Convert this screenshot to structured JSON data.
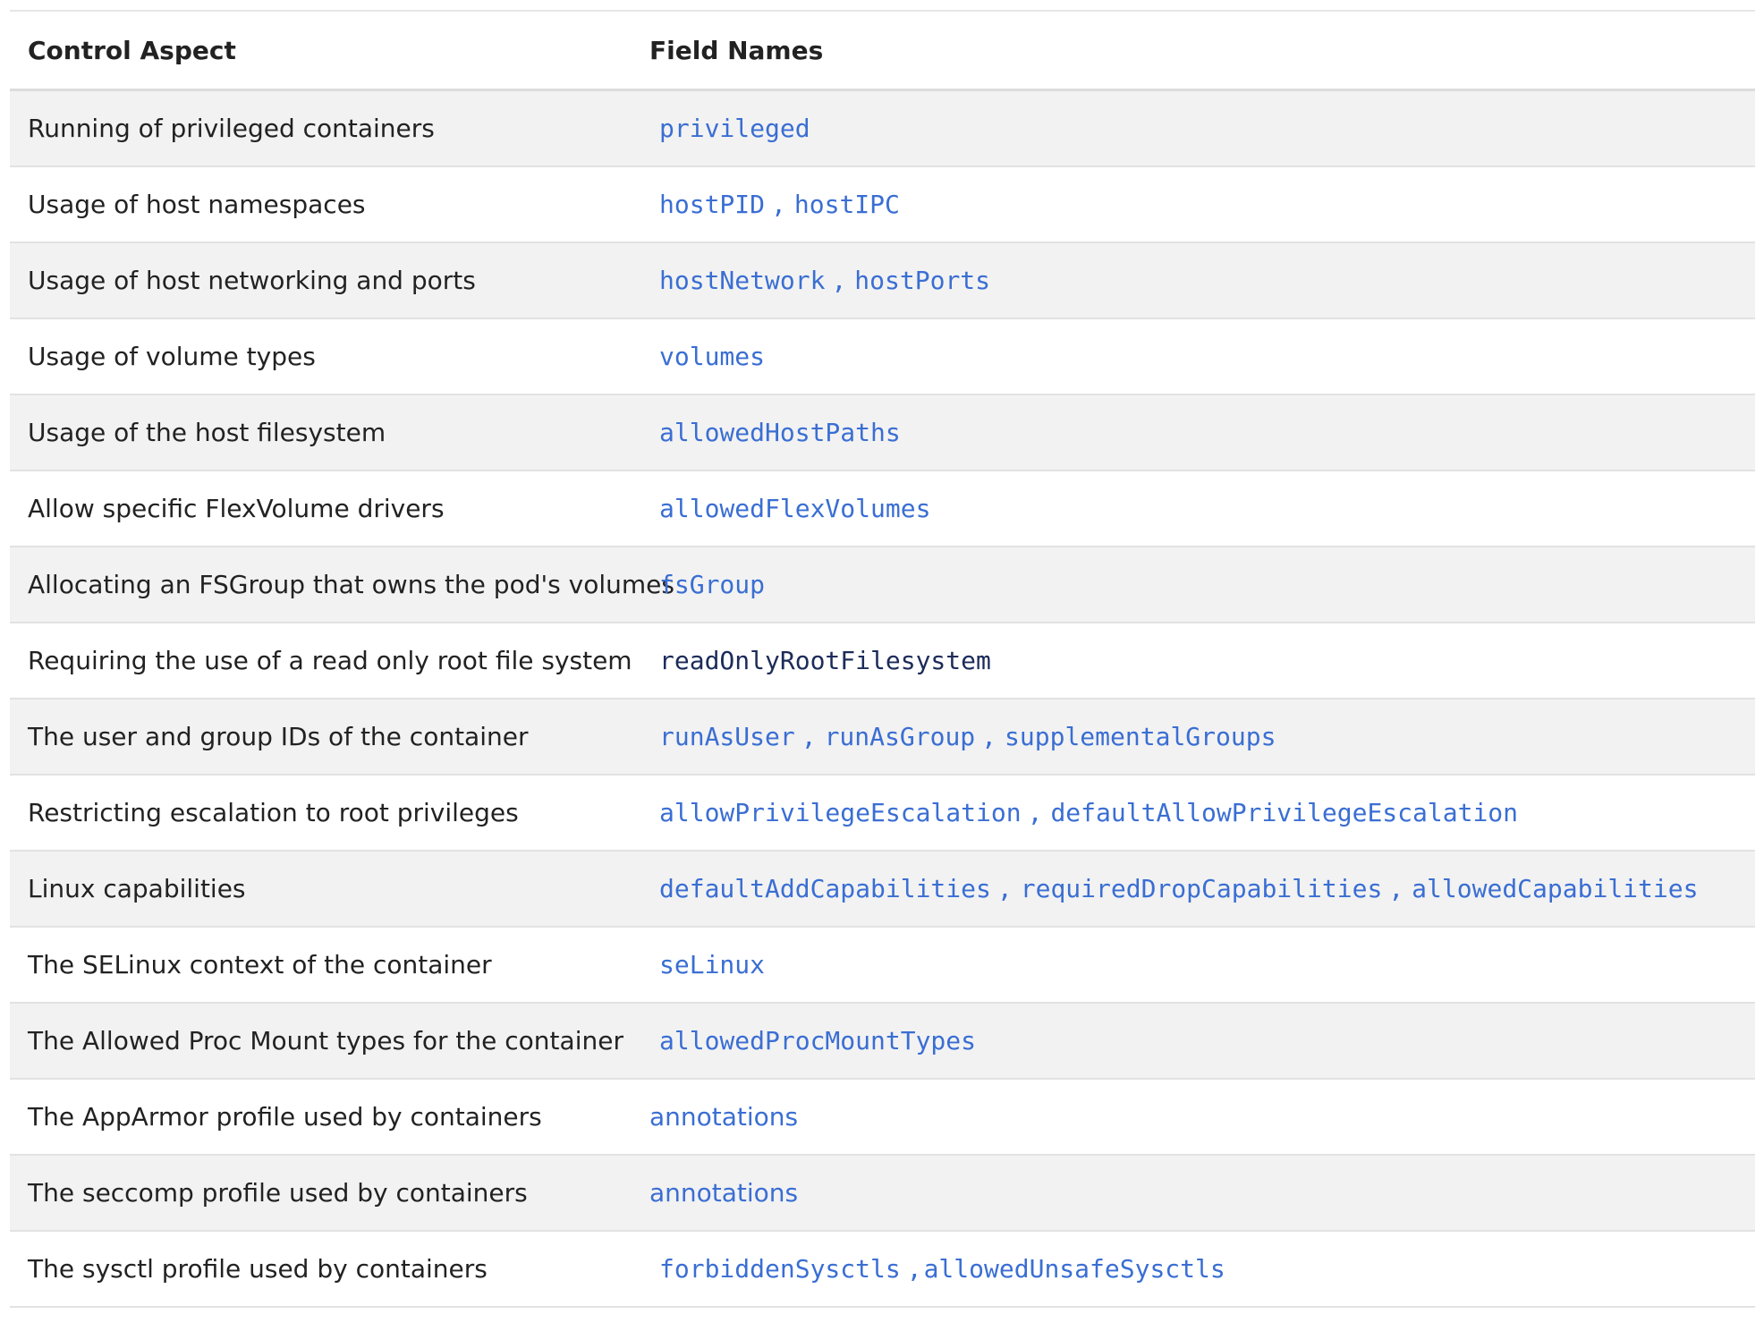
{
  "headers": {
    "aspect": "Control Aspect",
    "fields": "Field Names"
  },
  "rows": [
    {
      "aspect": "Running of privileged containers",
      "fields": [
        "privileged"
      ]
    },
    {
      "aspect": "Usage of host namespaces",
      "fields": [
        "hostPID",
        "hostIPC"
      ]
    },
    {
      "aspect": "Usage of host networking and ports",
      "fields": [
        "hostNetwork",
        "hostPorts"
      ]
    },
    {
      "aspect": "Usage of volume types",
      "fields": [
        "volumes"
      ]
    },
    {
      "aspect": "Usage of the host filesystem",
      "fields": [
        "allowedHostPaths"
      ]
    },
    {
      "aspect": "Allow specific FlexVolume drivers",
      "fields": [
        "allowedFlexVolumes"
      ]
    },
    {
      "aspect": "Allocating an FSGroup that owns the pod's volumes",
      "fields": [
        "fsGroup"
      ]
    },
    {
      "aspect": "Requiring the use of a read only root file system",
      "fields": [
        "readOnlyRootFilesystem"
      ]
    },
    {
      "aspect": "The user and group IDs of the container",
      "fields": [
        "runAsUser",
        "runAsGroup",
        "supplementalGroups"
      ]
    },
    {
      "aspect": "Restricting escalation to root privileges",
      "fields": [
        "allowPrivilegeEscalation",
        "defaultAllowPrivilegeEscalation"
      ]
    },
    {
      "aspect": "Linux capabilities",
      "fields": [
        "defaultAddCapabilities",
        "requiredDropCapabilities",
        "allowedCapabilities"
      ]
    },
    {
      "aspect": "The SELinux context of the container",
      "fields": [
        "seLinux"
      ]
    },
    {
      "aspect": "The Allowed Proc Mount types for the container",
      "fields": [
        "allowedProcMountTypes"
      ]
    },
    {
      "aspect": "The AppArmor profile used by containers",
      "fields": [
        "annotations"
      ]
    },
    {
      "aspect": "The seccomp profile used by containers",
      "fields": [
        "annotations"
      ]
    },
    {
      "aspect": "The sysctl profile used by containers",
      "fields": [
        "forbiddenSysctls",
        "allowedUnsafeSysctls"
      ]
    }
  ],
  "separator": ",",
  "colors": {
    "link": "#3a6ed3",
    "code_dark": "#1c2b5a",
    "row_shade": "#f2f2f2",
    "text": "#222222"
  }
}
